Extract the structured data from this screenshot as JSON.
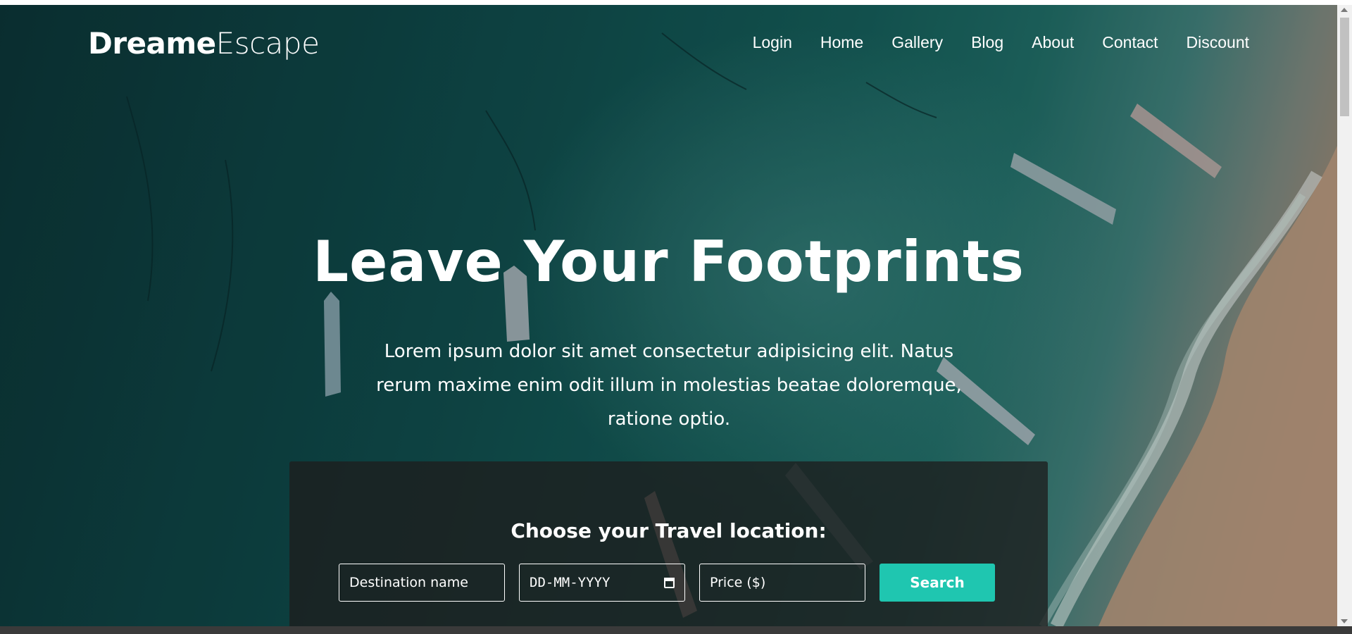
{
  "header": {
    "logo_bold": "Dreame",
    "logo_light": "Escape",
    "nav": [
      "Login",
      "Home",
      "Gallery",
      "Blog",
      "About",
      "Contact",
      "Discount"
    ]
  },
  "hero": {
    "headline": "Leave Your Footprints",
    "lead": "Lorem ipsum dolor sit amet consectetur adipisicing elit. Natus rerum maxime enim odit illum in molestias beatae doloremque, ratione optio."
  },
  "search": {
    "title": "Choose your Travel location:",
    "destination_placeholder": "Destination name",
    "date_placeholder": "DD-MM-YYYY",
    "price_placeholder": "Price ($)",
    "button_label": "Search"
  },
  "colors": {
    "accent": "#1fc6b0",
    "panel": "#1e1e1e"
  }
}
